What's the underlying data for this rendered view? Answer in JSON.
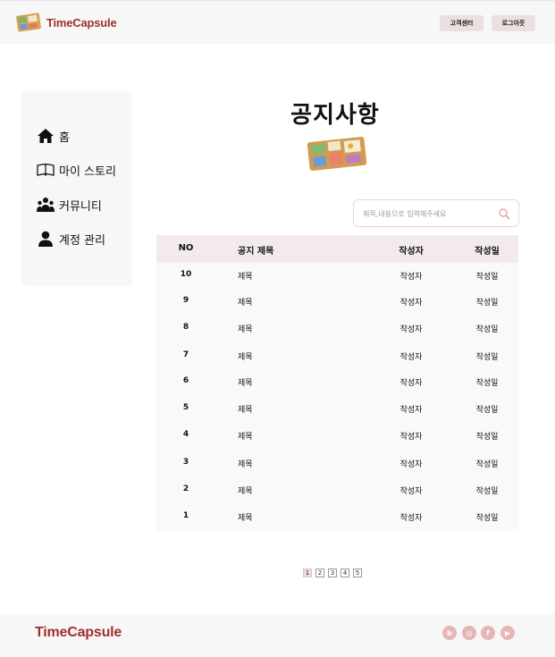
{
  "header": {
    "brand": "TimeCapsule",
    "customer_center": "고객센터",
    "logout": "로그아웃"
  },
  "sidebar": {
    "items": [
      {
        "label": "홈",
        "icon": "home-icon"
      },
      {
        "label": "마이 스토리",
        "icon": "book-icon"
      },
      {
        "label": "커뮤니티",
        "icon": "community-icon"
      },
      {
        "label": "계정 관리",
        "icon": "user-icon"
      }
    ]
  },
  "main": {
    "title": "공지사항",
    "search_placeholder": "제목,내용으로 입력해주세요"
  },
  "table": {
    "headers": {
      "no": "NO",
      "title": "공지 제목",
      "author": "작성자",
      "date": "작성일"
    },
    "rows": [
      {
        "no": "10",
        "title": "제목",
        "author": "작성자",
        "date": "작성일"
      },
      {
        "no": "9",
        "title": "제목",
        "author": "작성자",
        "date": "작성일"
      },
      {
        "no": "8",
        "title": "제목",
        "author": "작성자",
        "date": "작성일"
      },
      {
        "no": "7",
        "title": "제목",
        "author": "작성자",
        "date": "작성일"
      },
      {
        "no": "6",
        "title": "제목",
        "author": "작성자",
        "date": "작성일"
      },
      {
        "no": "5",
        "title": "제목",
        "author": "작성자",
        "date": "작성일"
      },
      {
        "no": "4",
        "title": "제목",
        "author": "작성자",
        "date": "작성일"
      },
      {
        "no": "3",
        "title": "제목",
        "author": "작성자",
        "date": "작성일"
      },
      {
        "no": "2",
        "title": "제목",
        "author": "작성자",
        "date": "작성일"
      },
      {
        "no": "1",
        "title": "제목",
        "author": "작성자",
        "date": "작성일"
      }
    ]
  },
  "pagination": {
    "pages": [
      "1",
      "2",
      "3",
      "4",
      "5"
    ],
    "current": "1"
  },
  "footer": {
    "brand": "TimeCapsule",
    "social": [
      {
        "icon": "blog-icon",
        "glyph": "b"
      },
      {
        "icon": "instagram-icon",
        "glyph": "◎"
      },
      {
        "icon": "facebook-icon",
        "glyph": "f"
      },
      {
        "icon": "youtube-icon",
        "glyph": "▶"
      }
    ]
  },
  "colors": {
    "brand": "#9e2f2f",
    "header_bg": "#f8f7f7",
    "table_head": "#f3ebeb",
    "social": "#e6b5b5"
  }
}
